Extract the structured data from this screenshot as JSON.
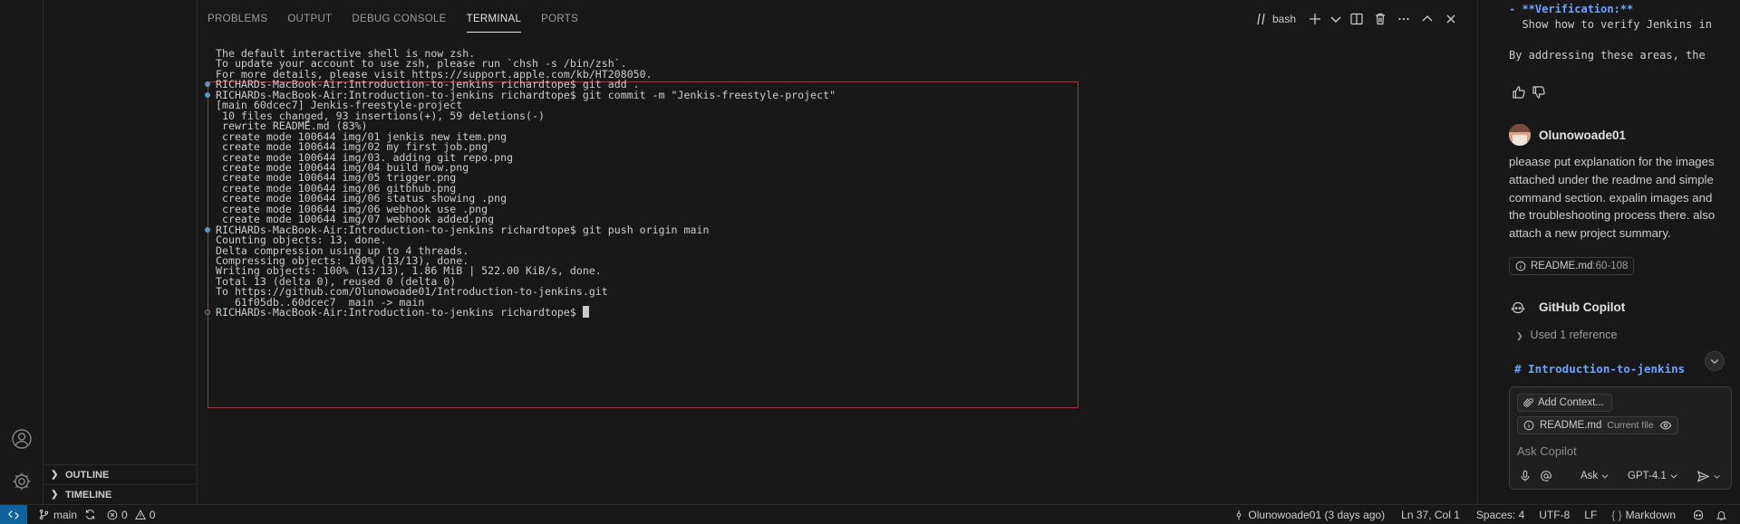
{
  "panel": {
    "tabs": [
      {
        "label": "PROBLEMS",
        "active": false
      },
      {
        "label": "OUTPUT",
        "active": false
      },
      {
        "label": "DEBUG CONSOLE",
        "active": false
      },
      {
        "label": "TERMINAL",
        "active": true
      },
      {
        "label": "PORTS",
        "active": false
      }
    ],
    "terminal_name": "bash"
  },
  "sidebar": {
    "sections": [
      {
        "label": "OUTLINE"
      },
      {
        "label": "TIMELINE"
      }
    ]
  },
  "terminal": {
    "lines": [
      {
        "text": "The default interactive shell is now zsh.",
        "marker": "none"
      },
      {
        "text": "To update your account to use zsh, please run `chsh -s /bin/zsh`.",
        "marker": "none"
      },
      {
        "text": "For more details, please visit https://support.apple.com/kb/HT208050.",
        "marker": "none"
      },
      {
        "text": "RICHARDs-MacBook-Air:Introduction-to-jenkins richardtope$ git add .",
        "marker": "filled"
      },
      {
        "text": "RICHARDs-MacBook-Air:Introduction-to-jenkins richardtope$ git commit -m \"Jenkis-freestyle-project\"",
        "marker": "filled"
      },
      {
        "text": "[main 60dcec7] Jenkis-freestyle-project",
        "marker": "none"
      },
      {
        "text": " 10 files changed, 93 insertions(+), 59 deletions(-)",
        "marker": "none"
      },
      {
        "text": " rewrite README.md (83%)",
        "marker": "none"
      },
      {
        "text": " create mode 100644 img/01 jenkis new item.png",
        "marker": "none"
      },
      {
        "text": " create mode 100644 img/02 my first job.png",
        "marker": "none"
      },
      {
        "text": " create mode 100644 img/03. adding git repo.png",
        "marker": "none"
      },
      {
        "text": " create mode 100644 img/04 build now.png",
        "marker": "none"
      },
      {
        "text": " create mode 100644 img/05 trigger.png",
        "marker": "none"
      },
      {
        "text": " create mode 100644 img/06 gitbhub.png",
        "marker": "none"
      },
      {
        "text": " create mode 100644 img/06 status showing .png",
        "marker": "none"
      },
      {
        "text": " create mode 100644 img/06 webhook use .png",
        "marker": "none"
      },
      {
        "text": " create mode 100644 img/07 webhook added.png",
        "marker": "none"
      },
      {
        "text": "RICHARDs-MacBook-Air:Introduction-to-jenkins richardtope$ git push origin main",
        "marker": "filled"
      },
      {
        "text": "Counting objects: 13, done.",
        "marker": "none"
      },
      {
        "text": "Delta compression using up to 4 threads.",
        "marker": "none"
      },
      {
        "text": "Compressing objects: 100% (13/13), done.",
        "marker": "none"
      },
      {
        "text": "Writing objects: 100% (13/13), 1.86 MiB | 522.00 KiB/s, done.",
        "marker": "none"
      },
      {
        "text": "Total 13 (delta 0), reused 0 (delta 0)",
        "marker": "none"
      },
      {
        "text": "To https://github.com/Olunowoade01/Introduction-to-jenkins.git",
        "marker": "none"
      },
      {
        "text": "   61f05db..60dcec7  main -> main",
        "marker": "none"
      },
      {
        "text": "RICHARDs-MacBook-Air:Introduction-to-jenkins richardtope$ ",
        "marker": "hollow",
        "cursor": true
      }
    ]
  },
  "chat": {
    "snippet_lines": [
      "- **Verification:**",
      "  Show how to verify Jenkins in",
      "",
      "By addressing these areas, the"
    ],
    "user": {
      "name": "Olunowoade01",
      "message": "pleaase put explanation for the images attached under the readme and simple command section. expalin images and the troubleshooting process there. also attach a new project summary."
    },
    "reference": {
      "file": "README.md",
      "range": ":60-108"
    },
    "assistant": {
      "name": "GitHub Copilot",
      "used_refs": "Used 1 reference",
      "heading": "# Introduction-to-jenkins"
    },
    "input": {
      "add_context": "Add Context...",
      "file_name": "README.md",
      "file_tag": "Current file",
      "placeholder": "Ask Copilot",
      "mode": "Ask",
      "model": "GPT-4.1"
    }
  },
  "status_bar": {
    "branch": "main",
    "errors": "0",
    "warnings": "0",
    "blame": "Olunowoade01 (3 days ago)",
    "position": "Ln 37, Col 1",
    "spaces": "Spaces: 4",
    "encoding": "UTF-8",
    "eol": "LF",
    "language_icon": "{ }",
    "language": "Markdown"
  },
  "colors": {
    "background": "#181818",
    "accent": "#0e639c",
    "selection_border": "#a03a3a",
    "heading": "#6fa1ff"
  }
}
